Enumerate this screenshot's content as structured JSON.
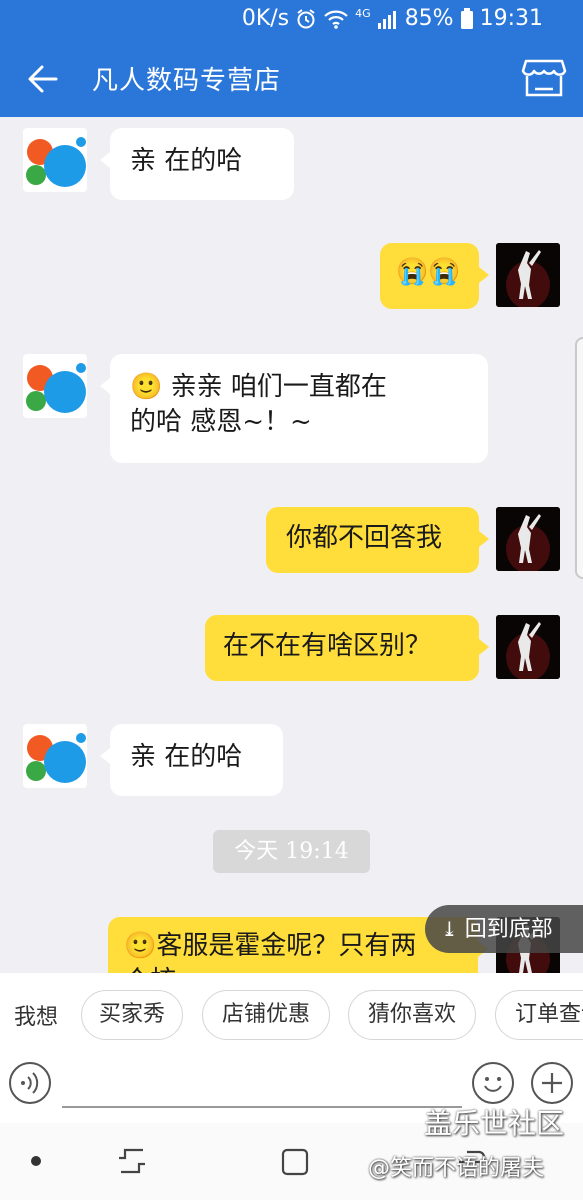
{
  "status_bar": {
    "speed": "0K/s",
    "network": "4G",
    "battery": "85%",
    "time": "19:31"
  },
  "header": {
    "title": "凡人数码专营店"
  },
  "messages": [
    {
      "text": "亲 在的哈"
    },
    {
      "text": "😭😭"
    },
    {
      "emoji": "🙂",
      "line1": " 亲亲  咱们一直都在",
      "line2": "的哈 感恩~！~"
    },
    {
      "text": "你都不回答我"
    },
    {
      "text": "在不在有啥区别？"
    },
    {
      "text": "亲 在的哈"
    },
    {
      "emoji": "🙂",
      "line1": "客服是霍金呢？只有两",
      "line2": "个核"
    }
  ],
  "timestamp": "今天 19:14",
  "back_to_bottom": "回到底部",
  "quick_bar": {
    "label": "我想",
    "chips": [
      "买家秀",
      "店铺优惠",
      "猜你喜欢",
      "订单查询"
    ]
  },
  "watermark": {
    "line1": "盖乐世社区",
    "line2": "@笑而不语的屠夫"
  },
  "colors": {
    "header": "#2b77d9",
    "outgoing_bubble": "#ffdd3a",
    "incoming_bubble": "#ffffff",
    "background": "#efeff4"
  }
}
